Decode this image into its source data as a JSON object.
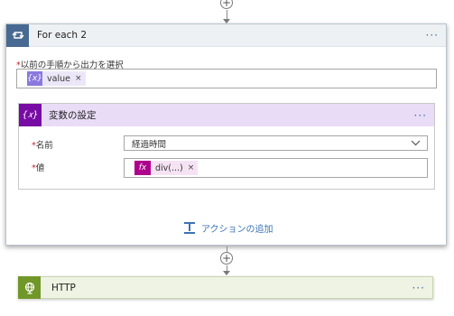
{
  "foreach": {
    "title": "For each 2",
    "more_label": "···",
    "select_label_required": "*",
    "select_label": "以前の手順から出力を選択",
    "select_token": {
      "icon": "{x}",
      "text": "value",
      "remove": "×"
    },
    "add_action_label": "アクションの追加"
  },
  "variable_card": {
    "title": "変数の設定",
    "more_label": "···",
    "name_required": "*",
    "name_label": "名前",
    "name_value": "経過時間",
    "value_required": "*",
    "value_label": "値",
    "value_token": {
      "icon": "fx",
      "text": "div(...)",
      "remove": "×"
    }
  },
  "http_card": {
    "title": "HTTP",
    "more_label": "···"
  },
  "icons": {
    "loop": "loop-icon",
    "variable": "variable-icon",
    "http": "globe-icon",
    "add_step": "plus-icon",
    "add_action": "add-action-icon",
    "dropdown": "chevron-down-icon"
  },
  "colors": {
    "loop_accent": "#486991",
    "variable_accent": "#770ba4",
    "expression_accent": "#ad008c",
    "http_accent": "#709727",
    "link": "#3c73b4",
    "required": "#c4262e"
  }
}
